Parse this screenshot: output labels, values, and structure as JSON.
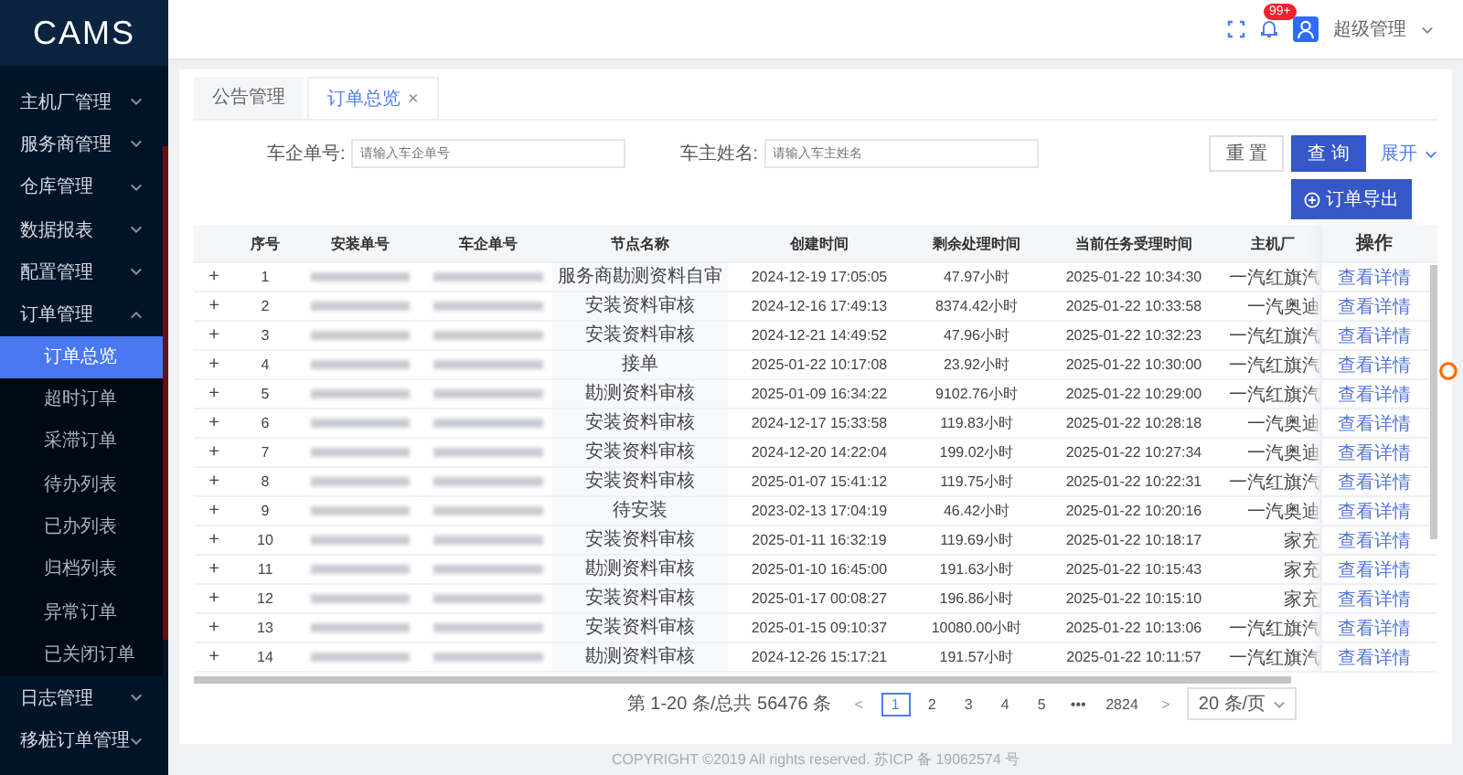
{
  "logo": "CAMS",
  "sidebar": {
    "items": [
      {
        "label": "主机厂管理",
        "expanded": false
      },
      {
        "label": "服务商管理",
        "expanded": false
      },
      {
        "label": "仓库管理",
        "expanded": false
      },
      {
        "label": "数据报表",
        "expanded": false
      },
      {
        "label": "配置管理",
        "expanded": false
      },
      {
        "label": "订单管理",
        "expanded": true,
        "children": [
          {
            "label": "订单总览",
            "selected": true
          },
          {
            "label": "超时订单",
            "selected": false
          },
          {
            "label": "采滞订单",
            "selected": false
          },
          {
            "label": "待办列表",
            "selected": false
          },
          {
            "label": "已办列表",
            "selected": false
          },
          {
            "label": "归档列表",
            "selected": false
          },
          {
            "label": "异常订单",
            "selected": false
          },
          {
            "label": "已关闭订单",
            "selected": false
          }
        ]
      },
      {
        "label": "日志管理",
        "expanded": false
      },
      {
        "label": "移桩订单管理",
        "expanded": false
      }
    ]
  },
  "header": {
    "badge": "99+",
    "user": "超级管理"
  },
  "tabs": [
    {
      "label": "公告管理",
      "selected": false
    },
    {
      "label": "订单总览",
      "selected": true,
      "close": "×"
    }
  ],
  "filters": [
    {
      "label": "车企单号:",
      "placeholder": "请输入车企单号"
    },
    {
      "label": "车主姓名:",
      "placeholder": "请输入车主姓名"
    }
  ],
  "buttons": {
    "reset": "重 置",
    "search": "查 询",
    "expand": "展开",
    "export": "订单导出"
  },
  "table": {
    "columns": [
      "序号",
      "安装单号",
      "车企单号",
      "节点名称",
      "创建时间",
      "剩余处理时间",
      "当前任务受理时间",
      "主机厂",
      "操作"
    ],
    "rows": [
      {
        "expand": "+",
        "no": "1",
        "node": "服务商勘测资料自审",
        "created": "2024-12-19 17:05:05",
        "remaining": "47.97小时",
        "accepted": "2025-01-22 10:34:30",
        "oem": "一汽红旗汽",
        "action": "查看详情"
      },
      {
        "expand": "+",
        "no": "2",
        "node": "安装资料审核",
        "created": "2024-12-16 17:49:13",
        "remaining": "8374.42小时",
        "accepted": "2025-01-22 10:33:58",
        "oem": "一汽奥迪",
        "action": "查看详情"
      },
      {
        "expand": "+",
        "no": "3",
        "node": "安装资料审核",
        "created": "2024-12-21 14:49:52",
        "remaining": "47.96小时",
        "accepted": "2025-01-22 10:32:23",
        "oem": "一汽红旗汽",
        "action": "查看详情"
      },
      {
        "expand": "+",
        "no": "4",
        "node": "接单",
        "created": "2025-01-22 10:17:08",
        "remaining": "23.92小时",
        "accepted": "2025-01-22 10:30:00",
        "oem": "一汽红旗汽",
        "action": "查看详情"
      },
      {
        "expand": "+",
        "no": "5",
        "node": "勘测资料审核",
        "created": "2025-01-09 16:34:22",
        "remaining": "9102.76小时",
        "accepted": "2025-01-22 10:29:00",
        "oem": "一汽红旗汽",
        "action": "查看详情"
      },
      {
        "expand": "+",
        "no": "6",
        "node": "安装资料审核",
        "created": "2024-12-17 15:33:58",
        "remaining": "119.83小时",
        "accepted": "2025-01-22 10:28:18",
        "oem": "一汽奥迪",
        "action": "查看详情"
      },
      {
        "expand": "+",
        "no": "7",
        "node": "安装资料审核",
        "created": "2024-12-20 14:22:04",
        "remaining": "199.02小时",
        "accepted": "2025-01-22 10:27:34",
        "oem": "一汽奥迪",
        "action": "查看详情"
      },
      {
        "expand": "+",
        "no": "8",
        "node": "安装资料审核",
        "created": "2025-01-07 15:41:12",
        "remaining": "119.75小时",
        "accepted": "2025-01-22 10:22:31",
        "oem": "一汽红旗汽",
        "action": "查看详情"
      },
      {
        "expand": "+",
        "no": "9",
        "node": "待安装",
        "created": "2023-02-13 17:04:19",
        "remaining": "46.42小时",
        "accepted": "2025-01-22 10:20:16",
        "oem": "一汽奥迪",
        "action": "查看详情"
      },
      {
        "expand": "+",
        "no": "10",
        "node": "安装资料审核",
        "created": "2025-01-11 16:32:19",
        "remaining": "119.69小时",
        "accepted": "2025-01-22 10:18:17",
        "oem": "家充",
        "action": "查看详情"
      },
      {
        "expand": "+",
        "no": "11",
        "node": "勘测资料审核",
        "created": "2025-01-10 16:45:00",
        "remaining": "191.63小时",
        "accepted": "2025-01-22 10:15:43",
        "oem": "家充",
        "action": "查看详情"
      },
      {
        "expand": "+",
        "no": "12",
        "node": "安装资料审核",
        "created": "2025-01-17 00:08:27",
        "remaining": "196.86小时",
        "accepted": "2025-01-22 10:15:10",
        "oem": "家充",
        "action": "查看详情"
      },
      {
        "expand": "+",
        "no": "13",
        "node": "安装资料审核",
        "created": "2025-01-15 09:10:37",
        "remaining": "10080.00小时",
        "accepted": "2025-01-22 10:13:06",
        "oem": "一汽红旗汽",
        "action": "查看详情"
      },
      {
        "expand": "+",
        "no": "14",
        "node": "勘测资料审核",
        "created": "2024-12-26 15:17:21",
        "remaining": "191.57小时",
        "accepted": "2025-01-22 10:11:57",
        "oem": "一汽红旗汽",
        "action": "查看详情"
      }
    ]
  },
  "pagination": {
    "total": "第 1-20 条/总共 56476 条",
    "prev": "<",
    "pages": [
      {
        "label": "1",
        "selected": true
      },
      {
        "label": "2",
        "selected": false
      },
      {
        "label": "3",
        "selected": false
      },
      {
        "label": "4",
        "selected": false
      },
      {
        "label": "5",
        "selected": false
      },
      {
        "label": "•••",
        "selected": false
      },
      {
        "label": "2824",
        "selected": false
      }
    ],
    "next": ">",
    "size": "20 条/页"
  },
  "footer": "COPYRIGHT ©2019 All rights reserved. 苏ICP 备 19062574 号"
}
